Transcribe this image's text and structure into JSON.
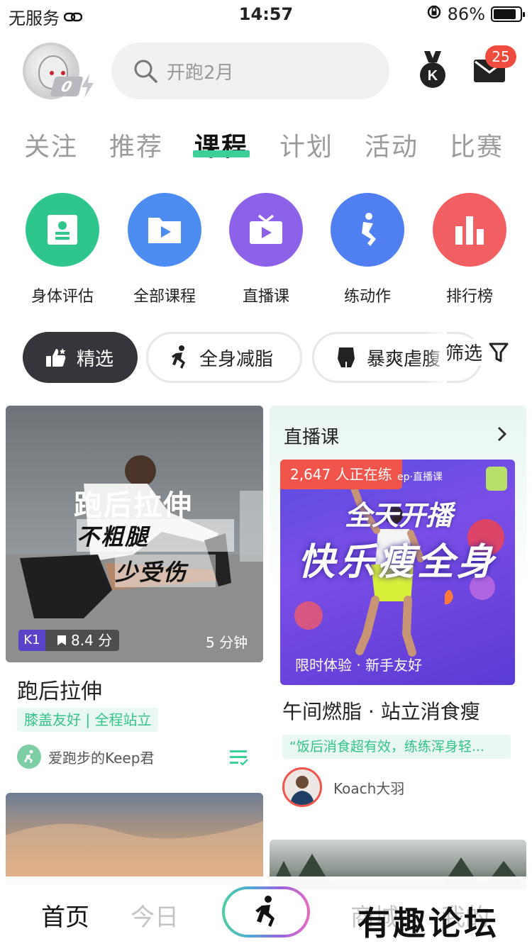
{
  "status_bar": {
    "carrier": "无服务",
    "time": "14:57",
    "battery": "86%",
    "battery_level": 0.86
  },
  "header": {
    "search_placeholder": "开跑2月",
    "level": "0",
    "mail_badge": "25"
  },
  "tabs": [
    {
      "label": "关注",
      "active": false
    },
    {
      "label": "推荐",
      "active": false
    },
    {
      "label": "课程",
      "active": true
    },
    {
      "label": "计划",
      "active": false
    },
    {
      "label": "活动",
      "active": false
    },
    {
      "label": "比赛",
      "active": false
    }
  ],
  "entries": [
    {
      "label": "身体评估",
      "icon": "body-assessment-icon",
      "color": "#2fc68e"
    },
    {
      "label": "全部课程",
      "icon": "folder-play-icon",
      "color": "#4d8cf1"
    },
    {
      "label": "直播课",
      "icon": "tv-icon",
      "color": "#8d62e8"
    },
    {
      "label": "练动作",
      "icon": "exercise-figure-icon",
      "color": "#4f7ff1"
    },
    {
      "label": "排行榜",
      "icon": "bar-chart-icon",
      "color": "#f15f63"
    }
  ],
  "chips": [
    {
      "label": "精选",
      "icon": "thumbs-up-icon",
      "active": true
    },
    {
      "label": "全身减脂",
      "icon": "running-figure-icon",
      "active": false
    },
    {
      "label": "暴爽虐腹",
      "icon": "torso-icon",
      "active": false
    }
  ],
  "filter_label": "筛选",
  "card_left": {
    "image_title": "跑后拉伸",
    "image_line2": "不粗腿",
    "image_line3": "少受伤",
    "level": "K1",
    "rating": "8.4 分",
    "duration": "5 分钟",
    "title": "跑后拉伸",
    "tags": "膝盖友好 | 全程站立",
    "author": "爱跑步的Keep君"
  },
  "card_live": {
    "section": "直播课",
    "viewers": "2,647 人正在练",
    "logo_text": "ep·直播课",
    "banner_top": "全天开播",
    "banner_main": "快乐瘦全身",
    "banner_sub": "限时体验 · 新手友好",
    "title": "午间燃脂 · 站立消食瘦",
    "quote": "“饭后消食超有效，练练浑身轻...",
    "coach": "Koach大羽"
  },
  "bottom_nav": {
    "home": "首页",
    "today": "今日",
    "mall": "商城",
    "mine": "我的"
  },
  "watermark": "有趣论坛"
}
